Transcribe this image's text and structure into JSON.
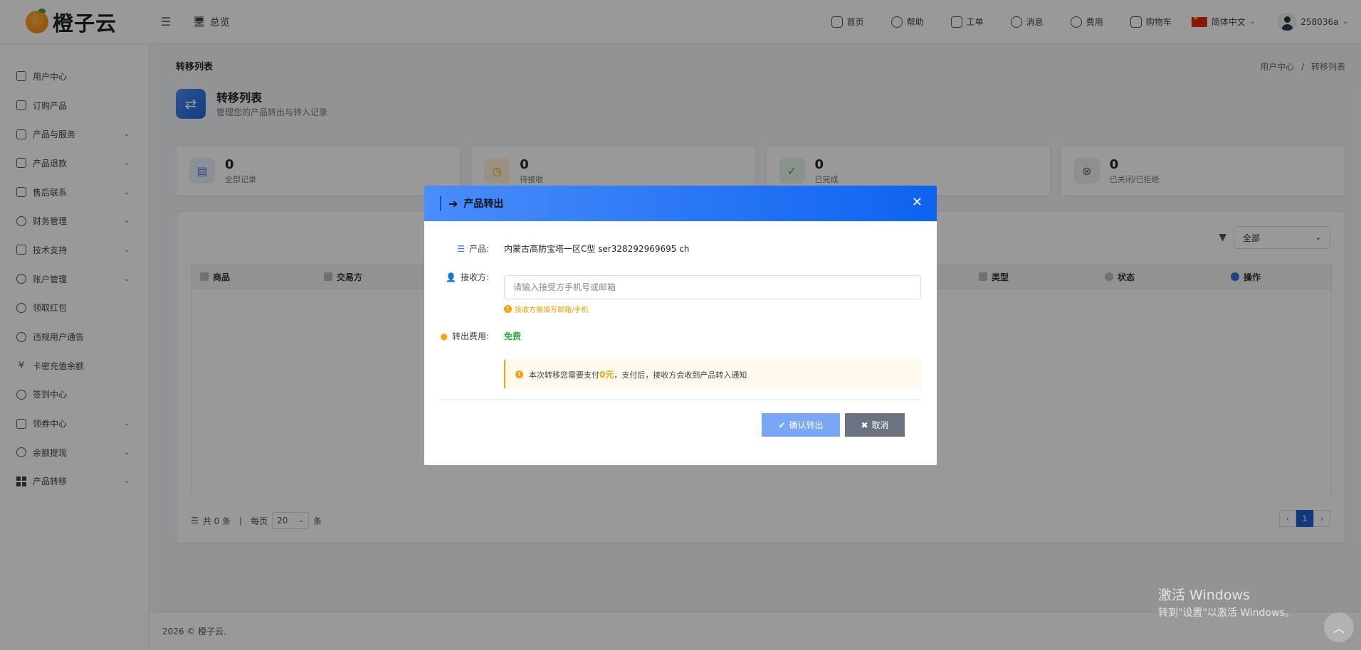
{
  "header": {
    "logo_text": "橙子云",
    "overview_label": "总览",
    "nav": [
      {
        "label": "首页",
        "icon": "monitor-icon"
      },
      {
        "label": "帮助",
        "icon": "help-icon"
      },
      {
        "label": "工单",
        "icon": "ticket-icon"
      },
      {
        "label": "消息",
        "icon": "bell-icon"
      },
      {
        "label": "费用",
        "icon": "dollar-icon"
      },
      {
        "label": "购物车",
        "icon": "cart-icon"
      }
    ],
    "language": "简体中文",
    "username": "258036a"
  },
  "sidebar": {
    "items": [
      {
        "label": "用户中心",
        "icon": "home-icon",
        "expandable": false
      },
      {
        "label": "订购产品",
        "icon": "cart-icon",
        "expandable": false
      },
      {
        "label": "产品与服务",
        "icon": "briefcase-icon",
        "expandable": true
      },
      {
        "label": "产品退款",
        "icon": "sliders-icon",
        "expandable": true
      },
      {
        "label": "售后联系",
        "icon": "chat-icon",
        "expandable": true
      },
      {
        "label": "财务管理",
        "icon": "dollar-icon",
        "expandable": true
      },
      {
        "label": "技术支持",
        "icon": "list-icon",
        "expandable": true
      },
      {
        "label": "账户管理",
        "icon": "user-icon",
        "expandable": true
      },
      {
        "label": "领取红包",
        "icon": "clock-icon",
        "expandable": false
      },
      {
        "label": "违规用户通告",
        "icon": "bell-icon",
        "expandable": false
      },
      {
        "label": "卡密充值余额",
        "icon": "yen-icon",
        "expandable": false
      },
      {
        "label": "签到中心",
        "icon": "smile-icon",
        "expandable": false
      },
      {
        "label": "领券中心",
        "icon": "calendar-icon",
        "expandable": true
      },
      {
        "label": "余额提现",
        "icon": "dollar-icon",
        "expandable": true
      },
      {
        "label": "产品转移",
        "icon": "grid-icon",
        "expandable": true
      }
    ]
  },
  "page": {
    "title": "转移列表",
    "breadcrumb_home": "用户中心",
    "breadcrumb_sep": "/",
    "breadcrumb_current": "转移列表",
    "head_title": "转移列表",
    "head_subtitle": "管理您的产品转出与转入记录"
  },
  "stats": [
    {
      "value": "0",
      "label": "全部记录",
      "color": "#e8eefb",
      "icon_color": "#4a7be0"
    },
    {
      "value": "0",
      "label": "待接收",
      "color": "#fdf2dc",
      "icon_color": "#e9a100"
    },
    {
      "value": "0",
      "label": "已完成",
      "color": "#e3f5e8",
      "icon_color": "#2bb24c"
    },
    {
      "value": "0",
      "label": "已关闭/已拒绝",
      "color": "#eeeeee",
      "icon_color": "#666666"
    }
  ],
  "table": {
    "filter_value": "全部",
    "columns": [
      "商品",
      "交易方",
      "类型",
      "状态",
      "操作"
    ],
    "total_text": "共 0 条",
    "sep": "|",
    "per_page_label": "每页",
    "per_page_value": "20",
    "per_page_unit": "条",
    "current_page": "1",
    "prev": "‹",
    "next": "›"
  },
  "footer": {
    "text": "2026 © 橙子云."
  },
  "modal": {
    "title": "产品转出",
    "product_label": "产品:",
    "product_value": "内蒙古高防宝塔一区C型 ser328292969695 ch",
    "receiver_label": "接收方:",
    "receiver_placeholder": "请输入接受方手机号或邮箱",
    "receiver_value": "",
    "receiver_hint": "接收方需填写邮箱/手机",
    "fee_label": "转出费用:",
    "fee_value": "免费",
    "notice_prefix": "本次转移您需要支付",
    "notice_amount": "0元",
    "notice_suffix": "，支付后，接收方会收到产品转入通知",
    "confirm_label": "确认转出",
    "cancel_label": "取消"
  },
  "watermark": {
    "line1": "激活 Windows",
    "line2": "转到\"设置\"以激活 Windows。"
  }
}
